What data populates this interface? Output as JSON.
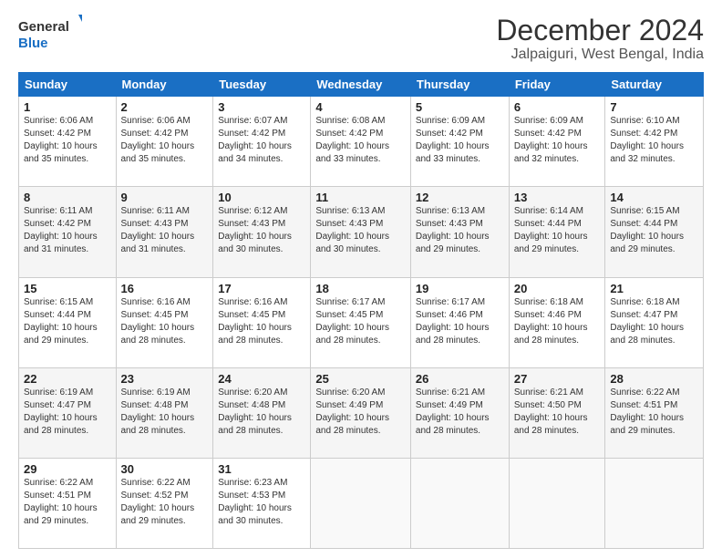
{
  "logo": {
    "text_general": "General",
    "text_blue": "Blue"
  },
  "header": {
    "title": "December 2024",
    "subtitle": "Jalpaiguri, West Bengal, India"
  },
  "weekdays": [
    "Sunday",
    "Monday",
    "Tuesday",
    "Wednesday",
    "Thursday",
    "Friday",
    "Saturday"
  ],
  "weeks": [
    [
      {
        "day": "1",
        "info": "Sunrise: 6:06 AM\nSunset: 4:42 PM\nDaylight: 10 hours and 35 minutes."
      },
      {
        "day": "2",
        "info": "Sunrise: 6:06 AM\nSunset: 4:42 PM\nDaylight: 10 hours and 35 minutes."
      },
      {
        "day": "3",
        "info": "Sunrise: 6:07 AM\nSunset: 4:42 PM\nDaylight: 10 hours and 34 minutes."
      },
      {
        "day": "4",
        "info": "Sunrise: 6:08 AM\nSunset: 4:42 PM\nDaylight: 10 hours and 33 minutes."
      },
      {
        "day": "5",
        "info": "Sunrise: 6:09 AM\nSunset: 4:42 PM\nDaylight: 10 hours and 33 minutes."
      },
      {
        "day": "6",
        "info": "Sunrise: 6:09 AM\nSunset: 4:42 PM\nDaylight: 10 hours and 32 minutes."
      },
      {
        "day": "7",
        "info": "Sunrise: 6:10 AM\nSunset: 4:42 PM\nDaylight: 10 hours and 32 minutes."
      }
    ],
    [
      {
        "day": "8",
        "info": "Sunrise: 6:11 AM\nSunset: 4:42 PM\nDaylight: 10 hours and 31 minutes."
      },
      {
        "day": "9",
        "info": "Sunrise: 6:11 AM\nSunset: 4:43 PM\nDaylight: 10 hours and 31 minutes."
      },
      {
        "day": "10",
        "info": "Sunrise: 6:12 AM\nSunset: 4:43 PM\nDaylight: 10 hours and 30 minutes."
      },
      {
        "day": "11",
        "info": "Sunrise: 6:13 AM\nSunset: 4:43 PM\nDaylight: 10 hours and 30 minutes."
      },
      {
        "day": "12",
        "info": "Sunrise: 6:13 AM\nSunset: 4:43 PM\nDaylight: 10 hours and 29 minutes."
      },
      {
        "day": "13",
        "info": "Sunrise: 6:14 AM\nSunset: 4:44 PM\nDaylight: 10 hours and 29 minutes."
      },
      {
        "day": "14",
        "info": "Sunrise: 6:15 AM\nSunset: 4:44 PM\nDaylight: 10 hours and 29 minutes."
      }
    ],
    [
      {
        "day": "15",
        "info": "Sunrise: 6:15 AM\nSunset: 4:44 PM\nDaylight: 10 hours and 29 minutes."
      },
      {
        "day": "16",
        "info": "Sunrise: 6:16 AM\nSunset: 4:45 PM\nDaylight: 10 hours and 28 minutes."
      },
      {
        "day": "17",
        "info": "Sunrise: 6:16 AM\nSunset: 4:45 PM\nDaylight: 10 hours and 28 minutes."
      },
      {
        "day": "18",
        "info": "Sunrise: 6:17 AM\nSunset: 4:45 PM\nDaylight: 10 hours and 28 minutes."
      },
      {
        "day": "19",
        "info": "Sunrise: 6:17 AM\nSunset: 4:46 PM\nDaylight: 10 hours and 28 minutes."
      },
      {
        "day": "20",
        "info": "Sunrise: 6:18 AM\nSunset: 4:46 PM\nDaylight: 10 hours and 28 minutes."
      },
      {
        "day": "21",
        "info": "Sunrise: 6:18 AM\nSunset: 4:47 PM\nDaylight: 10 hours and 28 minutes."
      }
    ],
    [
      {
        "day": "22",
        "info": "Sunrise: 6:19 AM\nSunset: 4:47 PM\nDaylight: 10 hours and 28 minutes."
      },
      {
        "day": "23",
        "info": "Sunrise: 6:19 AM\nSunset: 4:48 PM\nDaylight: 10 hours and 28 minutes."
      },
      {
        "day": "24",
        "info": "Sunrise: 6:20 AM\nSunset: 4:48 PM\nDaylight: 10 hours and 28 minutes."
      },
      {
        "day": "25",
        "info": "Sunrise: 6:20 AM\nSunset: 4:49 PM\nDaylight: 10 hours and 28 minutes."
      },
      {
        "day": "26",
        "info": "Sunrise: 6:21 AM\nSunset: 4:49 PM\nDaylight: 10 hours and 28 minutes."
      },
      {
        "day": "27",
        "info": "Sunrise: 6:21 AM\nSunset: 4:50 PM\nDaylight: 10 hours and 28 minutes."
      },
      {
        "day": "28",
        "info": "Sunrise: 6:22 AM\nSunset: 4:51 PM\nDaylight: 10 hours and 29 minutes."
      }
    ],
    [
      {
        "day": "29",
        "info": "Sunrise: 6:22 AM\nSunset: 4:51 PM\nDaylight: 10 hours and 29 minutes."
      },
      {
        "day": "30",
        "info": "Sunrise: 6:22 AM\nSunset: 4:52 PM\nDaylight: 10 hours and 29 minutes."
      },
      {
        "day": "31",
        "info": "Sunrise: 6:23 AM\nSunset: 4:53 PM\nDaylight: 10 hours and 30 minutes."
      },
      null,
      null,
      null,
      null
    ]
  ]
}
